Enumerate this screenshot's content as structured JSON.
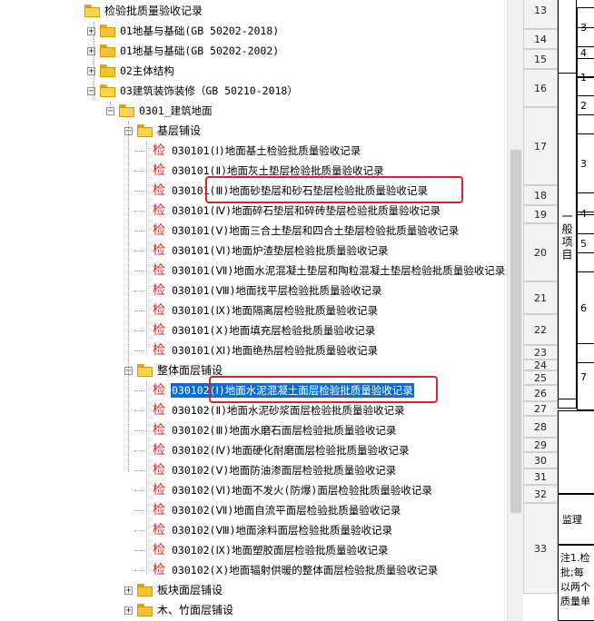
{
  "tree": {
    "nodes": [
      {
        "label": "检验批质量验收记录",
        "kind": "folder",
        "level": 0,
        "expanded": true
      },
      {
        "label": "01地基与基础(GB 50202-2018)",
        "kind": "folder",
        "level": 1,
        "expanded": false
      },
      {
        "label": "01地基与基础(GB 50202-2002)",
        "kind": "folder",
        "level": 1,
        "expanded": false
      },
      {
        "label": "02主体结构",
        "kind": "folder",
        "level": 1,
        "expanded": false
      },
      {
        "label": "03建筑装饰装修（GB 50210-2018）",
        "kind": "folder",
        "level": 1,
        "expanded": true
      },
      {
        "label": "0301_建筑地面",
        "kind": "folder",
        "level": 2,
        "expanded": true
      },
      {
        "label": "基层铺设",
        "kind": "folder",
        "level": 3,
        "expanded": true
      },
      {
        "label": "030101(Ⅰ)地面基土检验批质量验收记录",
        "kind": "leaf",
        "level": 4
      },
      {
        "label": "030101(Ⅱ)地面灰土垫层检验批质量验收记录",
        "kind": "leaf",
        "level": 4
      },
      {
        "label": "030101(Ⅲ)地面砂垫层和砂石垫层检验批质量验收记录",
        "kind": "leaf",
        "level": 4
      },
      {
        "label": "030101(Ⅳ)地面碎石垫层和碎砖垫层检验批质量验收记录",
        "kind": "leaf",
        "level": 4
      },
      {
        "label": "030101(Ⅴ)地面三合土垫层和四合土垫层检验批质量验收记录",
        "kind": "leaf",
        "level": 4
      },
      {
        "label": "030101(Ⅵ)地面炉渣垫层检验批质量验收记录",
        "kind": "leaf",
        "level": 4
      },
      {
        "label": "030101(Ⅶ)地面水泥混凝土垫层和陶粒混凝土垫层检验批质量验收记录",
        "kind": "leaf",
        "level": 4
      },
      {
        "label": "030101(Ⅷ)地面找平层检验批质量验收记录",
        "kind": "leaf",
        "level": 4
      },
      {
        "label": "030101(Ⅸ)地面隔离层检验批质量验收记录",
        "kind": "leaf",
        "level": 4
      },
      {
        "label": "030101(Ⅹ)地面填充层检验批质量验收记录",
        "kind": "leaf",
        "level": 4
      },
      {
        "label": "030101(Ⅺ)地面绝热层检验批质量验收记录",
        "kind": "leaf",
        "level": 4
      },
      {
        "label": "整体面层铺设",
        "kind": "folder",
        "level": 3,
        "expanded": true
      },
      {
        "label": "030102(Ⅰ)地面水泥混凝土面层检验批质量验收记录",
        "kind": "leaf",
        "level": 4,
        "selected": true
      },
      {
        "label": "030102(Ⅱ)地面水泥砂浆面层检验批质量验收记录",
        "kind": "leaf",
        "level": 4
      },
      {
        "label": "030102(Ⅲ)地面水磨石面层检验批质量验收记录",
        "kind": "leaf",
        "level": 4
      },
      {
        "label": "030102(Ⅳ)地面硬化耐磨面层检验批质量验收记录",
        "kind": "leaf",
        "level": 4
      },
      {
        "label": "030102(Ⅴ)地面防油渗面层检验批质量验收记录",
        "kind": "leaf",
        "level": 4
      },
      {
        "label": "030102(Ⅵ)地面不发火(防爆)面层检验批质量验收记录",
        "kind": "leaf",
        "level": 4
      },
      {
        "label": "030102(Ⅶ)地面自流平面层检验批质量验收记录",
        "kind": "leaf",
        "level": 4
      },
      {
        "label": "030102(Ⅷ)地面涂料面层检验批质量验收记录",
        "kind": "leaf",
        "level": 4
      },
      {
        "label": "030102(Ⅸ)地面塑胶面层检验批质量验收记录",
        "kind": "leaf",
        "level": 4
      },
      {
        "label": "030102(Ⅹ)地面辐射供暖的整体面层检验批质量验收记录",
        "kind": "leaf",
        "level": 4
      },
      {
        "label": "板块面层铺设",
        "kind": "folder",
        "level": 3,
        "expanded": false
      },
      {
        "label": "木、竹面层铺设",
        "kind": "folder",
        "level": 3,
        "expanded": false
      }
    ],
    "leaf_icon_text": "检",
    "highlight_rows": [
      9,
      19
    ]
  },
  "sheet": {
    "rows": [
      "13",
      "14",
      "15",
      "16",
      "17",
      "18",
      "19",
      "20",
      "21",
      "22",
      "23",
      "24",
      "25",
      "26",
      "27",
      "28",
      "29",
      "30",
      "31",
      "32",
      "33"
    ],
    "col_b": [
      "3",
      "4",
      "1",
      "2",
      "3",
      "4",
      "5",
      "6",
      "7"
    ],
    "vertical_label": "一般项目",
    "supervision_text": "监理",
    "note_text": "注1.检批;每以两个质量单"
  },
  "colors": {
    "highlight": "#dd2222",
    "selection": "#0a6cd6",
    "leaf_icon": "#e02020",
    "folder": "#f5c233"
  }
}
